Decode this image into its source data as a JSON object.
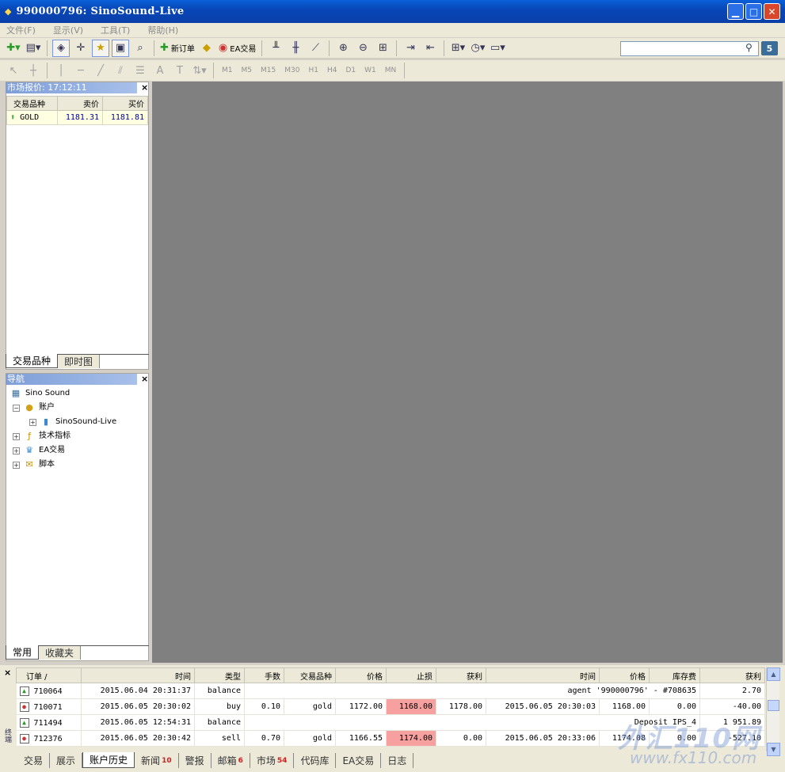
{
  "window": {
    "title": "990000796: SinoSound-Live"
  },
  "menu": [
    "文件(F)",
    "显示(V)",
    "工具(T)",
    "帮助(H)"
  ],
  "toolbar": {
    "new_order": "新订单",
    "ea_trading": "EA交易"
  },
  "timeframes": [
    "M1",
    "M5",
    "M15",
    "M30",
    "H1",
    "H4",
    "D1",
    "W1",
    "MN"
  ],
  "search": {
    "badge": "5"
  },
  "market_watch": {
    "title": "市场报价: 17:12:11",
    "columns": [
      "交易品种",
      "卖价",
      "买价"
    ],
    "rows": [
      {
        "symbol": "GOLD",
        "bid": "1181.31",
        "ask": "1181.81"
      }
    ],
    "tabs": [
      "交易品种",
      "即时图"
    ]
  },
  "navigator": {
    "title": "导航",
    "items": [
      "Sino Sound",
      "账户",
      "SinoSound-Live",
      "技术指标",
      "EA交易",
      "脚本"
    ],
    "tabs": [
      "常用",
      "收藏夹"
    ]
  },
  "terminal": {
    "side_label": "终端",
    "columns": [
      "订单 /",
      "时间",
      "类型",
      "手数",
      "交易品种",
      "价格",
      "止损",
      "获利",
      "时间",
      "价格",
      "库存费",
      "获利"
    ],
    "rows": [
      {
        "order": "710064",
        "time": "2015.06.04 20:31:37",
        "type": "balance",
        "note": "agent '990000796' - #708635",
        "profit": "2.70"
      },
      {
        "order": "710071",
        "time": "2015.06.05 20:30:02",
        "type": "buy",
        "lots": "0.10",
        "symbol": "gold",
        "price": "1172.00",
        "sl": "1168.00",
        "tp": "1178.00",
        "close_time": "2015.06.05 20:30:03",
        "close_price": "1168.00",
        "swap": "0.00",
        "profit": "-40.00"
      },
      {
        "order": "711494",
        "time": "2015.06.05 12:54:31",
        "type": "balance",
        "note": "Deposit IPS_4",
        "profit": "1 951.89"
      },
      {
        "order": "712376",
        "time": "2015.06.05 20:30:42",
        "type": "sell",
        "lots": "0.70",
        "symbol": "gold",
        "price": "1166.55",
        "sl": "1174.00",
        "tp": "0.00",
        "close_time": "2015.06.05 20:33:06",
        "close_price": "1174.08",
        "swap": "0.00",
        "profit": "-527.10"
      }
    ],
    "tabs": [
      {
        "label": "交易",
        "count": ""
      },
      {
        "label": "展示",
        "count": ""
      },
      {
        "label": "账户历史",
        "count": ""
      },
      {
        "label": "新闻",
        "count": "10"
      },
      {
        "label": "警报",
        "count": ""
      },
      {
        "label": "邮箱",
        "count": "6"
      },
      {
        "label": "市场",
        "count": "54"
      },
      {
        "label": "代码库",
        "count": ""
      },
      {
        "label": "EA交易",
        "count": ""
      },
      {
        "label": "日志",
        "count": ""
      }
    ]
  },
  "watermark": {
    "main": "外汇110网",
    "url": "www.fx110.com"
  }
}
